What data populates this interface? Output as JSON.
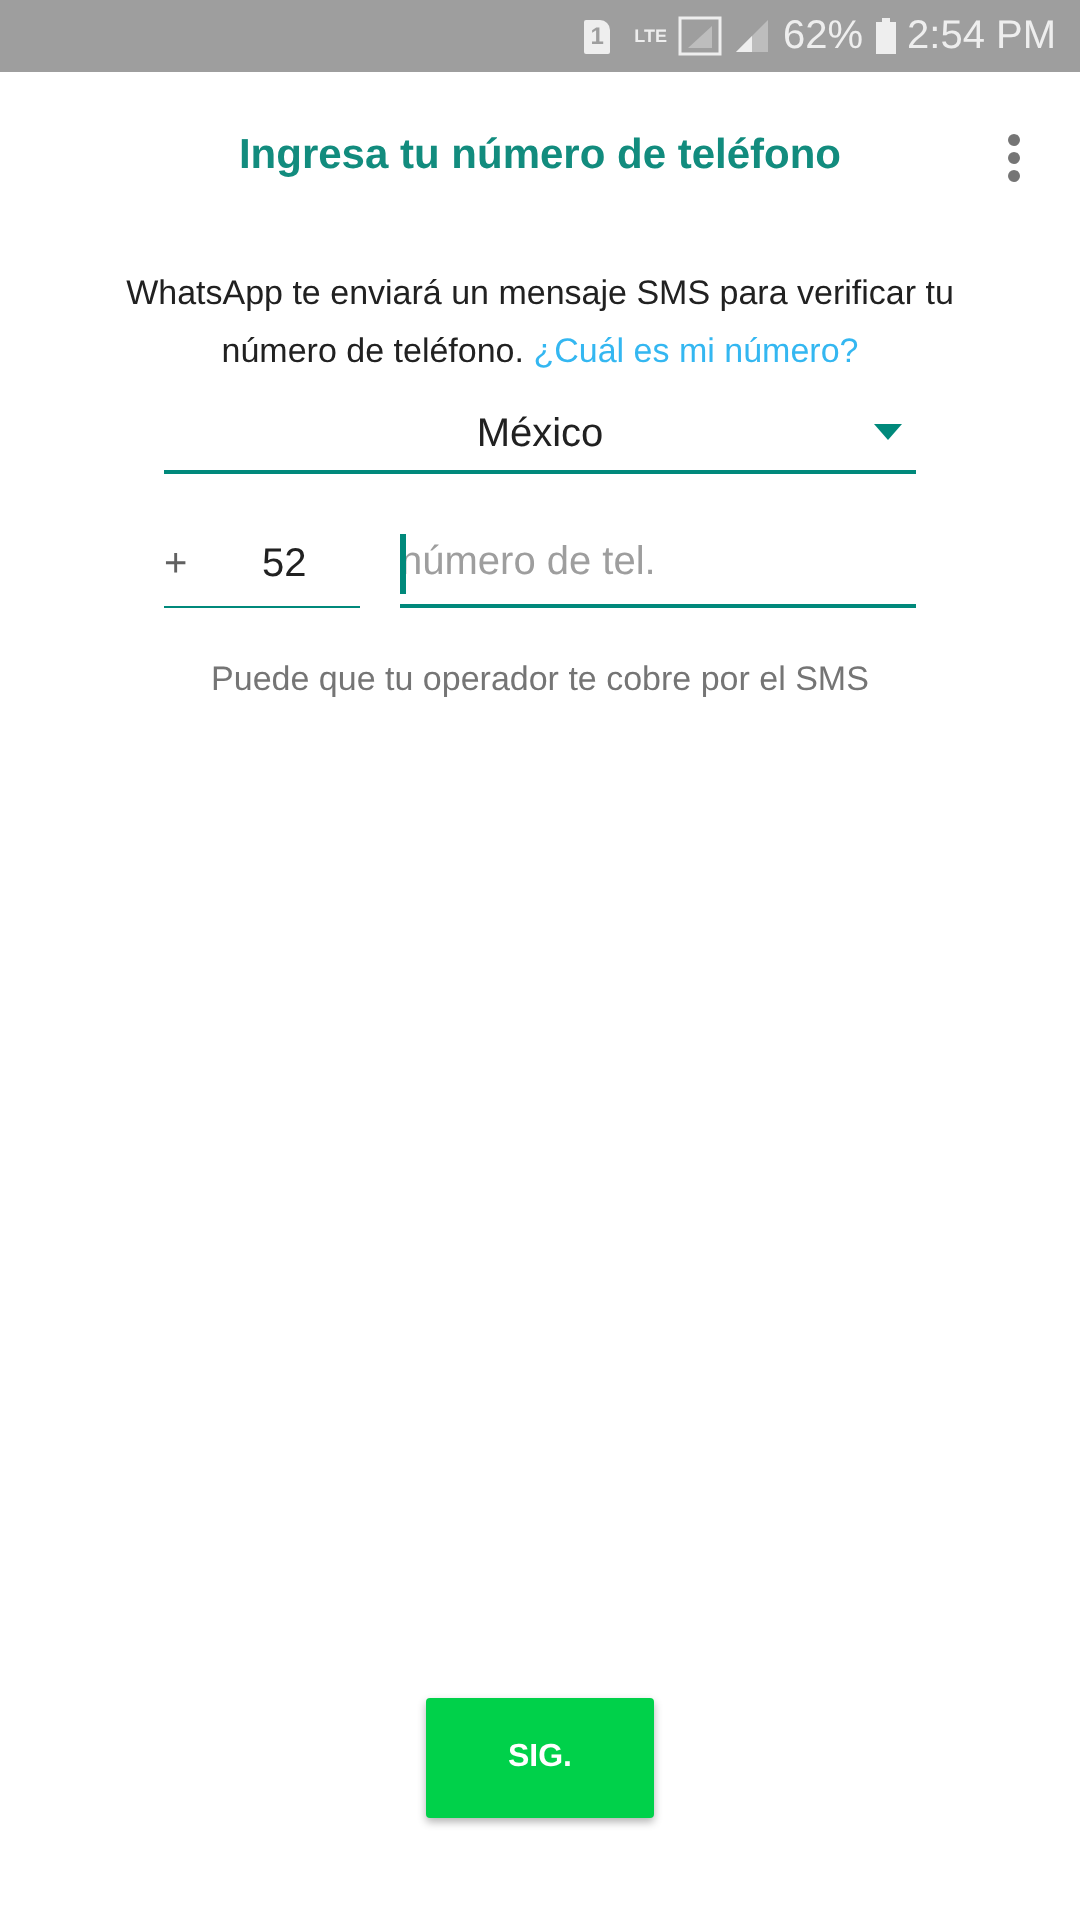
{
  "status_bar": {
    "sim": "1",
    "network": "LTE",
    "battery": "62%",
    "time": "2:54 PM"
  },
  "title": "Ingresa tu número de teléfono",
  "description": "WhatsApp te enviará un mensaje SMS para verificar tu número de teléfono.",
  "help_link": "¿Cuál es mi número?",
  "country": "México",
  "phone": {
    "plus": "+",
    "code": "52",
    "placeholder": "número de tel.",
    "focused": true
  },
  "note": "Puede que tu operador te cobre por el SMS",
  "next_button": "SIG."
}
